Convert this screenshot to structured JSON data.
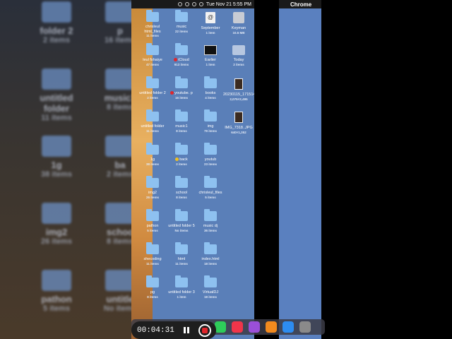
{
  "menubar": {
    "datetime": "Tue Nov 21  5:55 PM"
  },
  "chrome": {
    "app_name": "Chrome",
    "apple_glyph": ""
  },
  "background_ghosts": [
    {
      "name": "folder 2",
      "count": "2 items"
    },
    {
      "name": "untitled folder",
      "count": "11 items"
    },
    {
      "name": "1g",
      "count": "38 items"
    },
    {
      "name": "img2",
      "count": "26 items"
    },
    {
      "name": "pathon",
      "count": "5 items"
    }
  ],
  "background_ghosts_right": [
    {
      "name": "p",
      "count": "16 items"
    },
    {
      "name": "music1",
      "count": "8 items"
    },
    {
      "name": "ba",
      "count": "2 items"
    },
    {
      "name": "schoo",
      "count": "8 items"
    },
    {
      "name": "untitle",
      "count": "No items"
    }
  ],
  "desktop_items": [
    {
      "kind": "folder",
      "name": "chrisleul html_files",
      "count": "11 items",
      "col": 0,
      "row": 0
    },
    {
      "kind": "folder",
      "name": "music",
      "count": "22 items",
      "col": 1,
      "row": 0
    },
    {
      "kind": "doc",
      "name": "September",
      "count": "1 item",
      "col": 2,
      "row": 0,
      "glyph": "@"
    },
    {
      "kind": "dmg",
      "name": "Keyman",
      "count": "10.5 MB",
      "col": 3,
      "row": 0
    },
    {
      "kind": "folder",
      "name": "leul fshaiye",
      "count": "47 items",
      "col": 0,
      "row": 1
    },
    {
      "kind": "folder",
      "name": "iCloud",
      "count": "913 items",
      "col": 1,
      "row": 1,
      "tag": "#e0262b"
    },
    {
      "kind": "term",
      "name": "Earlier",
      "count": "1 item",
      "col": 2,
      "row": 1
    },
    {
      "kind": "tray",
      "name": "Today",
      "count": "2 items",
      "col": 3,
      "row": 1
    },
    {
      "kind": "folder",
      "name": "untitled folder 2",
      "count": "2 items",
      "col": 0,
      "row": 2
    },
    {
      "kind": "folder",
      "name": "youtube. p",
      "count": "16 items",
      "col": 1,
      "row": 2,
      "tag": "#e0262b"
    },
    {
      "kind": "folder",
      "name": "books",
      "count": "4 items",
      "col": 2,
      "row": 2
    },
    {
      "kind": "img",
      "name": "20230115_171514.jpg",
      "count": "2,075×2,495",
      "col": 3,
      "row": 2
    },
    {
      "kind": "folder",
      "name": "untitled folder",
      "count": "11 items",
      "col": 0,
      "row": 3
    },
    {
      "kind": "folder",
      "name": "music1",
      "count": "8 items",
      "col": 1,
      "row": 3
    },
    {
      "kind": "folder",
      "name": "img",
      "count": "79 items",
      "col": 2,
      "row": 3
    },
    {
      "kind": "img",
      "name": "IMG_7318..JPG",
      "count": "640×1,352",
      "col": 3,
      "row": 3
    },
    {
      "kind": "folder",
      "name": "1g",
      "count": "38 items",
      "col": 0,
      "row": 4
    },
    {
      "kind": "folder",
      "name": "back",
      "count": "2 items",
      "col": 1,
      "row": 4,
      "tag": "#f0c020"
    },
    {
      "kind": "folder",
      "name": "youtub",
      "count": "23 items",
      "col": 2,
      "row": 4
    },
    {
      "kind": "folder",
      "name": "img2",
      "count": "26 items",
      "col": 0,
      "row": 5
    },
    {
      "kind": "folder",
      "name": "school",
      "count": "8 items",
      "col": 1,
      "row": 5
    },
    {
      "kind": "folder",
      "name": "chrisleul_files",
      "count": "5 items",
      "col": 2,
      "row": 5
    },
    {
      "kind": "folder",
      "name": "pathon",
      "count": "5 items",
      "col": 0,
      "row": 6
    },
    {
      "kind": "folder",
      "name": "untitled folder 5",
      "count": "No items",
      "col": 1,
      "row": 6
    },
    {
      "kind": "folder",
      "name": "music dj",
      "count": "36 items",
      "col": 2,
      "row": 6
    },
    {
      "kind": "folder",
      "name": "shecoding",
      "count": "11 items",
      "col": 0,
      "row": 7
    },
    {
      "kind": "folder",
      "name": "html",
      "count": "11 items",
      "col": 1,
      "row": 7
    },
    {
      "kind": "folder",
      "name": "index.html",
      "count": "18 items",
      "col": 2,
      "row": 7
    },
    {
      "kind": "folder",
      "name": "pg",
      "count": "8 items",
      "col": 0,
      "row": 8
    },
    {
      "kind": "folder",
      "name": "untitled folder 3",
      "count": "1 item",
      "col": 1,
      "row": 8
    },
    {
      "kind": "folder",
      "name": "VirtualDJ",
      "count": "18 items",
      "col": 2,
      "row": 8
    }
  ],
  "dock_apps": [
    {
      "name": "facetime-icon",
      "color": "#2ecc5a"
    },
    {
      "name": "music-icon",
      "color": "#f0354a"
    },
    {
      "name": "podcasts-icon",
      "color": "#9b4fd8"
    },
    {
      "name": "books-icon",
      "color": "#f28a1e"
    },
    {
      "name": "app-store-icon",
      "color": "#2d8cf0"
    },
    {
      "name": "system-settings-icon",
      "color": "#8a8a8a"
    }
  ],
  "recorder": {
    "elapsed": "00:04:31"
  }
}
